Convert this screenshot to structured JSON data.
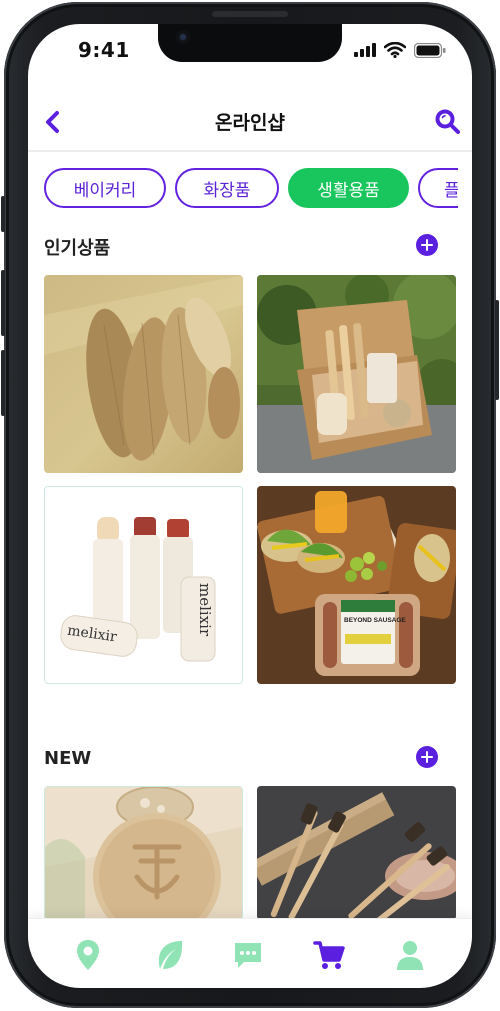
{
  "status_bar": {
    "time": "9:41"
  },
  "header": {
    "title": "온라인샵",
    "back_icon": "chevron-left-icon",
    "search_icon": "search-icon"
  },
  "categories": [
    {
      "label": "베이커리",
      "active": false
    },
    {
      "label": "화장품",
      "active": false
    },
    {
      "label": "생활용품",
      "active": true
    },
    {
      "label": "플",
      "active": false
    }
  ],
  "sections": {
    "popular": {
      "title": "인기상품",
      "add_icon": "plus-circle-icon"
    },
    "new": {
      "title": "NEW",
      "add_icon": "plus-circle-icon"
    }
  },
  "products": {
    "popular": [
      {
        "image": "loofah-sponges"
      },
      {
        "image": "bamboo-toothbrush-kit-box"
      },
      {
        "image": "melixir-lip-balms",
        "brand_text": "melixir"
      },
      {
        "image": "beyond-sausage-meal",
        "package_text": "BEYOND SAUSAGE"
      }
    ],
    "new": [
      {
        "image": "natural-soap-bar"
      },
      {
        "image": "bamboo-toothbrushes"
      }
    ]
  },
  "bottom_nav": [
    {
      "icon": "map-pin-icon",
      "active": false
    },
    {
      "icon": "leaf-icon",
      "active": false
    },
    {
      "icon": "chat-icon",
      "active": false
    },
    {
      "icon": "cart-icon",
      "active": true
    },
    {
      "icon": "user-icon",
      "active": false
    }
  ],
  "colors": {
    "accent_purple": "#5b1fe0",
    "active_green": "#19c55d",
    "nav_inactive": "#8fe3b4"
  }
}
